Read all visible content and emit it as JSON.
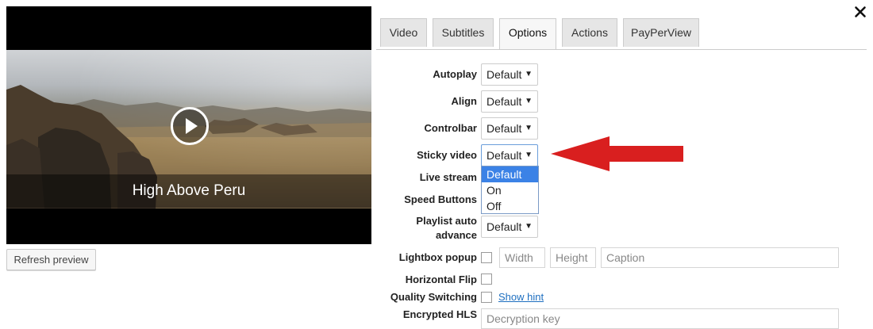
{
  "preview": {
    "title": "High Above Peru",
    "refresh_label": "Refresh preview"
  },
  "tabs": [
    {
      "label": "Video",
      "active": false
    },
    {
      "label": "Subtitles",
      "active": false
    },
    {
      "label": "Options",
      "active": true
    },
    {
      "label": "Actions",
      "active": false
    },
    {
      "label": "PayPerView",
      "active": false
    }
  ],
  "options": {
    "autoplay": {
      "label": "Autoplay",
      "value": "Default"
    },
    "align": {
      "label": "Align",
      "value": "Default"
    },
    "controlbar": {
      "label": "Controlbar",
      "value": "Default"
    },
    "sticky_video": {
      "label": "Sticky video",
      "value": "Default",
      "options": [
        "Default",
        "On",
        "Off"
      ],
      "highlighted": "Default"
    },
    "live_stream": {
      "label": "Live stream"
    },
    "speed_buttons": {
      "label": "Speed Buttons"
    },
    "playlist_auto_advance": {
      "label": "Playlist auto advance",
      "value": "Default"
    },
    "lightbox_popup": {
      "label": "Lightbox popup",
      "checked": false,
      "width_placeholder": "Width",
      "height_placeholder": "Height",
      "caption_placeholder": "Caption"
    },
    "horizontal_flip": {
      "label": "Horizontal Flip",
      "checked": false
    },
    "quality_switching": {
      "label": "Quality Switching",
      "checked": false,
      "hint_link": "Show hint"
    },
    "encrypted_hls": {
      "label": "Encrypted HLS",
      "placeholder": "Decryption key"
    }
  },
  "colors": {
    "accent": "#3b82e6",
    "annotation_arrow": "#d91f1f",
    "link": "#1e6fc0"
  },
  "icons": {
    "close": "close-icon",
    "play": "play-icon",
    "dropdown": "caret-down-icon",
    "annotation": "red-arrow-icon"
  }
}
